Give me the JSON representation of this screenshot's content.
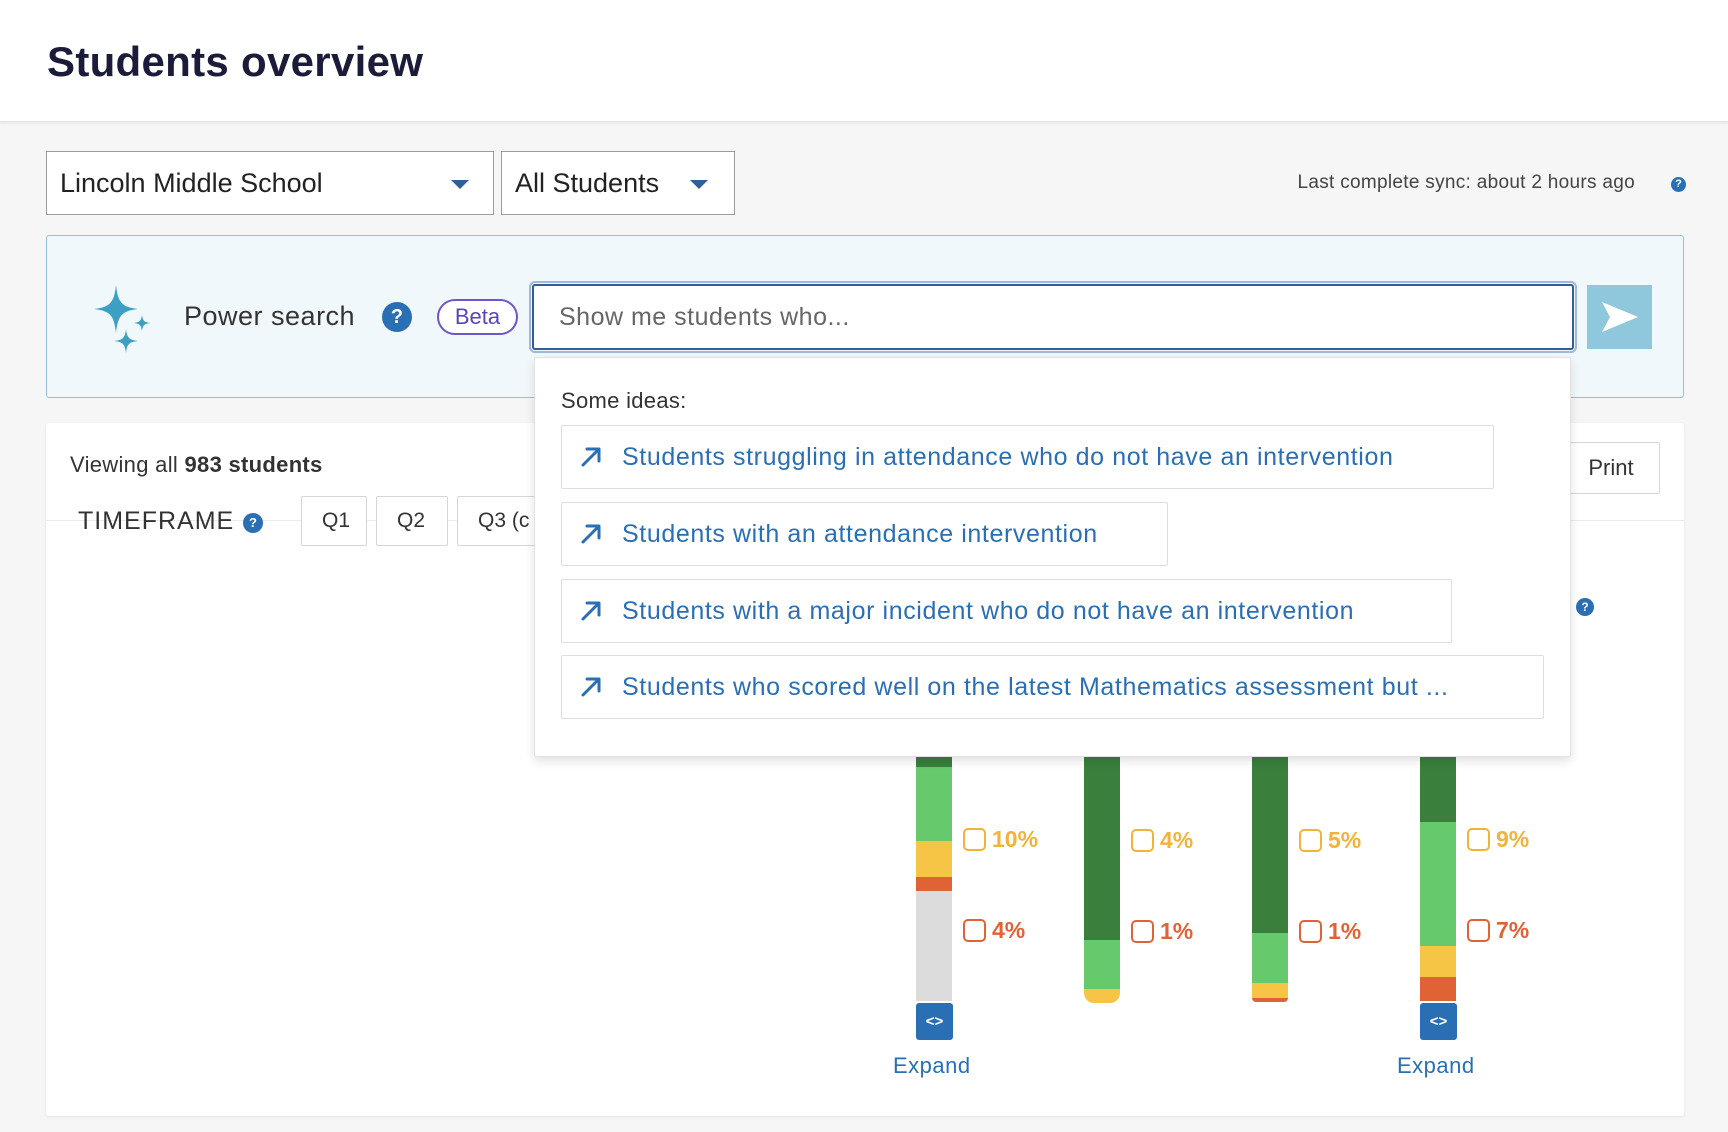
{
  "header": {
    "title": "Students overview"
  },
  "filters": {
    "school": "Lincoln Middle School",
    "students": "All Students",
    "sync_label": "Last complete sync:",
    "sync_value": "about 2 hours ago"
  },
  "power_search": {
    "label": "Power search",
    "badge": "Beta",
    "placeholder": "Show me students who...",
    "ideas_title": "Some ideas:",
    "ideas": [
      "Students struggling in attendance who do not have an intervention",
      "Students with an attendance intervention",
      "Students with a major incident who do not have an intervention",
      "Students who scored well on the latest Mathematics assessment but ..."
    ]
  },
  "overview": {
    "viewing_prefix": "Viewing all",
    "viewing_count": "983 students",
    "print_label": "Print",
    "timeframe_label": "TIMEFRAME",
    "timeframes": [
      "Q1",
      "Q2",
      "Q3 (c"
    ]
  },
  "chart_data": {
    "type": "bar",
    "stacked": true,
    "series_colors": {
      "dark_green": "#3a7f3c",
      "light_green": "#66c96b",
      "yellow": "#f6c545",
      "red": "#e06336",
      "gray": "#dcdcdc"
    },
    "bars": [
      {
        "yellow_pct": "10%",
        "red_pct": "4%",
        "expand": "Expand"
      },
      {
        "yellow_pct": "4%",
        "red_pct": "1%"
      },
      {
        "yellow_pct": "5%",
        "red_pct": "1%"
      },
      {
        "yellow_pct": "9%",
        "red_pct": "7%",
        "expand": "Expand"
      }
    ]
  },
  "icons": {
    "sparkle": "sparkle-icon",
    "send": "send-arrow-icon",
    "idea_arrow": "arrow-up-right-icon",
    "help": "question-circle-icon",
    "expand": "code-brackets-icon"
  }
}
